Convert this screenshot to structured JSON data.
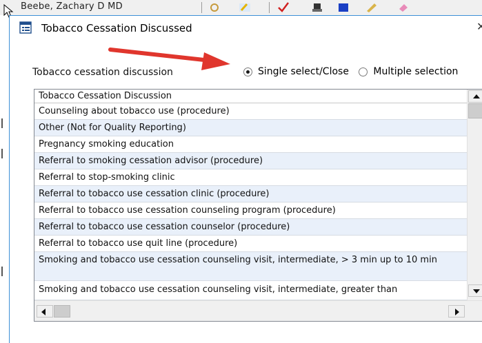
{
  "background_window": {
    "title_fragment": "Beebe, Zachary D MD"
  },
  "dialog": {
    "title": "Tobacco Cessation Discussed",
    "close_glyph": "✕",
    "section_label": "Tobacco cessation discussion",
    "selection_mode": {
      "options": [
        "Single select/Close",
        "Multiple selection"
      ],
      "selected": "Single select/Close"
    },
    "grid": {
      "column_header": "Tobacco Cessation Discussion",
      "rows": [
        "Counseling about tobacco use (procedure)",
        "Other (Not for Quality Reporting)",
        "Pregnancy smoking education",
        "Referral to smoking cessation advisor (procedure)",
        "Referral to stop-smoking clinic",
        "Referral to tobacco use cessation clinic (procedure)",
        "Referral to tobacco use cessation counseling program (procedure)",
        "Referral to tobacco use cessation counselor (procedure)",
        "Referral to tobacco use quit line (procedure)",
        "Smoking and tobacco use cessation counseling visit, intermediate, > 3 min up to 10 min",
        "Smoking and tobacco use cessation counseling visit, intermediate, greater than"
      ]
    }
  },
  "colors": {
    "annotation_arrow": "#e0362d",
    "alt_row": "#e9f0fa",
    "dialog_border": "#3c8fd6"
  },
  "icons": [
    "cursor-icon",
    "list-form-icon",
    "radio-selected-icon",
    "scroll-up-arrow-icon",
    "scroll-down-arrow-icon",
    "scroll-left-arrow-icon",
    "scroll-right-arrow-icon"
  ]
}
